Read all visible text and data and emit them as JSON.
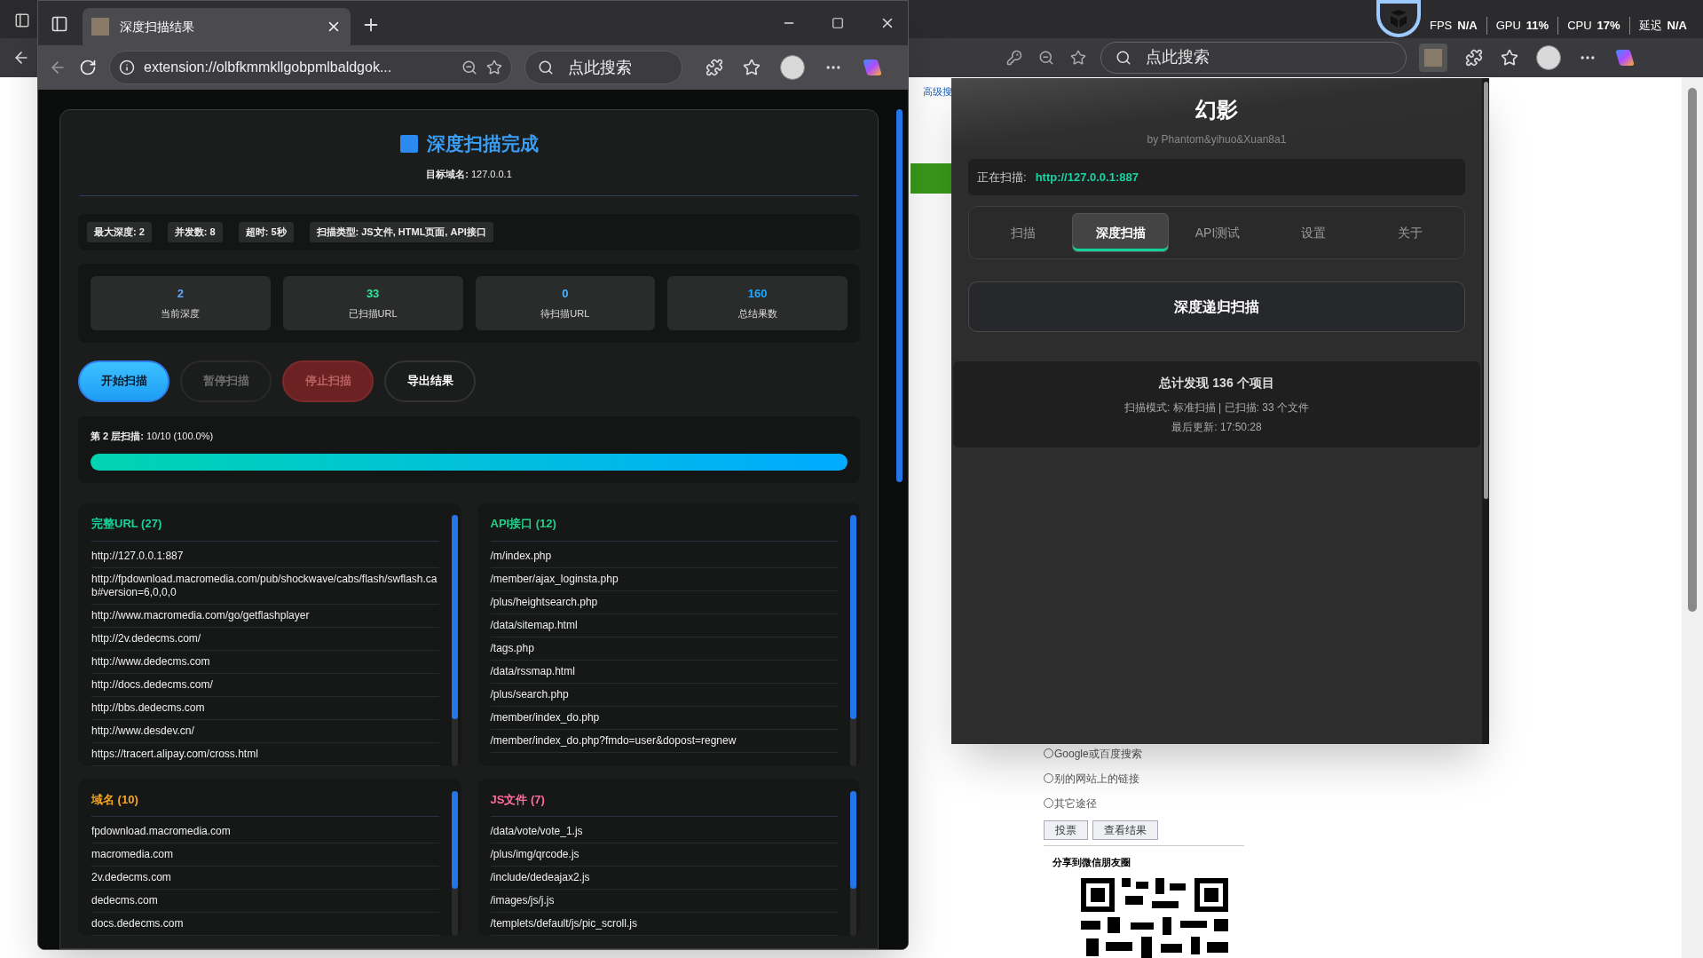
{
  "background_browser": {
    "search_placeholder": "点此搜索",
    "perf_overlay": [
      {
        "label": "FPS",
        "value": "N/A"
      },
      {
        "label": "GPU",
        "value": "11%"
      },
      {
        "label": "CPU",
        "value": "17%"
      },
      {
        "label": "延迟",
        "value": "N/A"
      }
    ],
    "page": {
      "link_text": "高级搜",
      "radio_options": [
        {
          "label": "Google或百度搜索",
          "selected": false
        },
        {
          "label": "别的网站上的链接",
          "selected": false
        },
        {
          "label": "其它途径",
          "selected": false
        }
      ],
      "buttons": [
        "投票",
        "查看结果"
      ],
      "share_heading": "分享到微信朋友圈"
    }
  },
  "window": {
    "tab_title": "深度扫描结果",
    "address": "extension://olbfkmmkllgobpmlbaldgok...",
    "search_placeholder": "点此搜索"
  },
  "report": {
    "title": "深度扫描完成",
    "target": "**目标域名:** 127.0.0.1",
    "config": [
      "最大深度: 2",
      "并发数: 8",
      "超时: 5秒",
      "扫描类型: JS文件, HTML页面, API接口"
    ],
    "stats": [
      {
        "value": "2",
        "label": "当前深度",
        "color": "#5aa9ff"
      },
      {
        "value": "33",
        "label": "已扫描URL",
        "color": "#2ee89a"
      },
      {
        "value": "0",
        "label": "待扫描URL",
        "color": "#4db4ff"
      },
      {
        "value": "160",
        "label": "总结果数",
        "color": "#1fa8ff"
      }
    ],
    "buttons": [
      {
        "label": "开始扫描",
        "kind": "primary"
      },
      {
        "label": "暂停扫描",
        "kind": "muted"
      },
      {
        "label": "停止扫描",
        "kind": "danger"
      },
      {
        "label": "导出结果",
        "kind": "outline"
      }
    ],
    "progress": {
      "label": "**第 2 层扫描:** 10/10 (100.0%)",
      "level": 1
    },
    "lists": [
      {
        "title": "完整URL (27)",
        "color": "#19d39a",
        "items": [
          "http://127.0.0.1:887",
          "http://fpdownload.macromedia.com/pub/shockwave/cabs/flash/swflash.cab#version=6,0,0,0",
          "http://www.macromedia.com/go/getflashplayer",
          "http://2v.dedecms.com/",
          "http://www.dedecms.com",
          "http://docs.dedecms.com/",
          "http://bbs.dedecms.com",
          "http://www.desdev.cn/",
          "https://tracert.alipay.com/cross.html"
        ]
      },
      {
        "title": "API接口 (12)",
        "color": "#22d08a",
        "items": [
          "/m/index.php",
          "/member/ajax_loginsta.php",
          "/plus/heightsearch.php",
          "/data/sitemap.html",
          "/tags.php",
          "/data/rssmap.html",
          "/plus/search.php",
          "/member/index_do.php",
          "/member/index_do.php?fmdo=user&dopost=regnew"
        ]
      },
      {
        "title": "域名 (10)",
        "color": "#f5a623",
        "items": [
          "fpdownload.macromedia.com",
          "macromedia.com",
          "2v.dedecms.com",
          "dedecms.com",
          "docs.dedecms.com"
        ]
      },
      {
        "title": "JS文件 (7)",
        "color": "#ff6b9a",
        "items": [
          "/data/vote/vote_1.js",
          "/plus/img/qrcode.js",
          "/include/dedeajax2.js",
          "/images/js/j.js",
          "/templets/default/js/pic_scroll.js"
        ]
      }
    ]
  },
  "popup": {
    "title": "幻影",
    "subtitle": "by Phantom&yihuo&Xuan8a1",
    "scanning_label": "正在扫描:",
    "scanning_url": "http://127.0.0.1:887",
    "tabs": [
      {
        "label": "扫描",
        "selected": false
      },
      {
        "label": "深度扫描",
        "selected": true
      },
      {
        "label": "API测试",
        "selected": false
      },
      {
        "label": "设置",
        "selected": false
      },
      {
        "label": "关于",
        "selected": false
      }
    ],
    "action_button": "深度递归扫描",
    "summary": {
      "headline": "总计发现 136 个项目",
      "mode": "扫描模式: 标准扫描 | 已扫描: 33 个文件",
      "updated": "最后更新: 17:50:28"
    }
  }
}
